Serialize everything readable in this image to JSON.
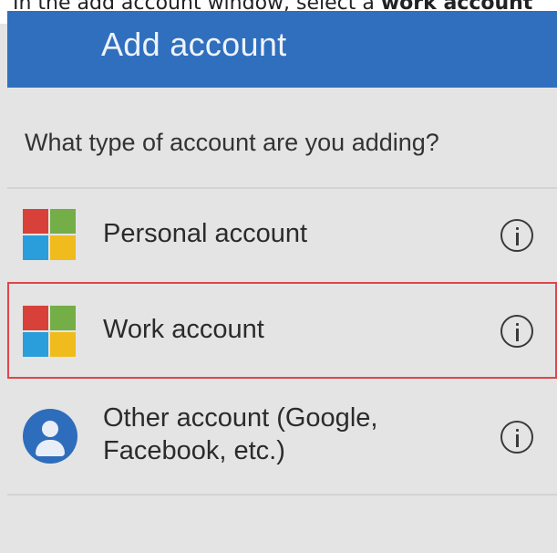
{
  "caption": {
    "prefix": "In the add account window, select a ",
    "bold": "work account"
  },
  "appbar": {
    "title": "Add account",
    "color": "#2f6fbe"
  },
  "question": "What type of account are you adding?",
  "options": [
    {
      "label": "Personal account",
      "icon": "microsoft-logo-icon",
      "info_icon": "info-icon"
    },
    {
      "label": "Work account",
      "icon": "microsoft-logo-icon",
      "info_icon": "info-icon",
      "highlighted": true,
      "highlight_color": "#e0454c"
    },
    {
      "label_line1": "Other account (Google,",
      "label_line2": "Facebook, etc.)",
      "icon": "person-icon",
      "info_icon": "info-icon"
    }
  ],
  "colors": {
    "background": "#e4e4e4",
    "ms_red": "#d8413a",
    "ms_green": "#73ae46",
    "ms_blue": "#2a9ddb",
    "ms_yellow": "#f0bb1c"
  }
}
